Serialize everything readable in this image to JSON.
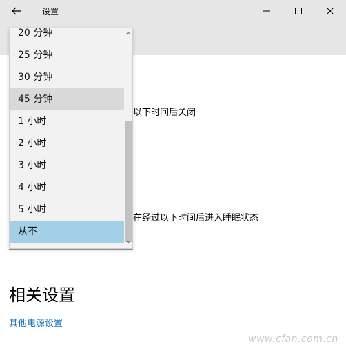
{
  "window": {
    "title": "设置"
  },
  "dropdown": {
    "items": [
      {
        "label": "20 分钟"
      },
      {
        "label": "25 分钟"
      },
      {
        "label": "30 分钟"
      },
      {
        "label": "45 分钟"
      },
      {
        "label": "1 小时"
      },
      {
        "label": "2 小时"
      },
      {
        "label": "3 小时"
      },
      {
        "label": "4 小时"
      },
      {
        "label": "5 小时"
      },
      {
        "label": "从不"
      }
    ],
    "hovered_item": "45 分钟",
    "selected_item": "从不"
  },
  "labels": {
    "screen_off_partial": "以下时间后关闭",
    "sleep_partial": "在经过以下时间后进入睡眠状态"
  },
  "related": {
    "title": "相关设置",
    "link": "其他电源设置"
  },
  "watermark": "www.cfan.com.cn",
  "colors": {
    "titlebar": "#e6e6e6",
    "selected": "#a3cfe7",
    "hover": "#d9d9d9",
    "link": "#1a73b8"
  }
}
